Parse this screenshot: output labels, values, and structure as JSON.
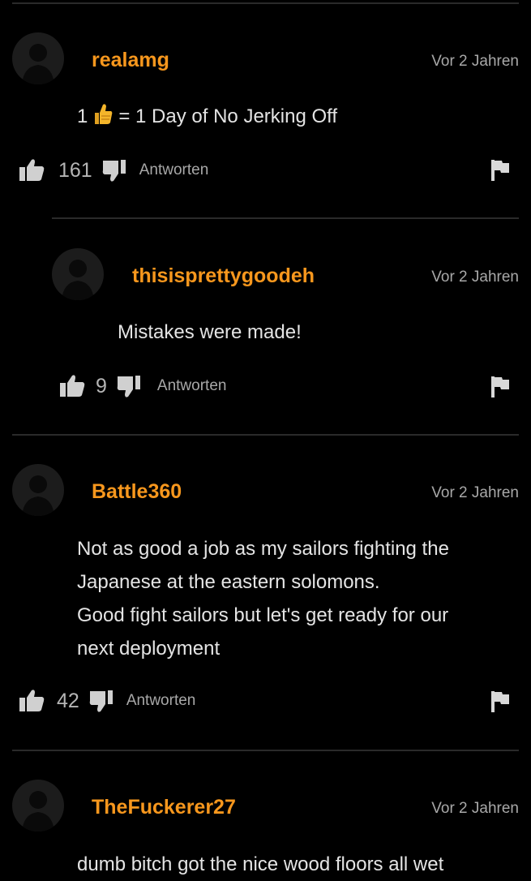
{
  "comments": [
    {
      "username": "realamg",
      "time": "Vor 2 Jahren",
      "text_pre": "1",
      "text_emoji": "thumbs-up-emoji",
      "text_post": "= 1 Day of No Jerking Off",
      "likes": "161",
      "reply_label": "Antworten"
    },
    {
      "username": "thisisprettygoodeh",
      "time": "Vor 2 Jahren",
      "text": "Mistakes were made!",
      "likes": "9",
      "reply_label": "Antworten"
    },
    {
      "username": "Battle360",
      "time": "Vor 2 Jahren",
      "lines": [
        "Not as good a job as my sailors fighting the",
        "Japanese at the eastern solomons.",
        "Good fight sailors but let's get ready for our",
        "next deployment"
      ],
      "likes": "42",
      "reply_label": "Antworten"
    },
    {
      "username": "TheFuckerer27",
      "time": "Vor 2 Jahren",
      "text": "dumb bitch got the nice wood floors all wet"
    }
  ],
  "colors": {
    "background": "#000000",
    "username": "#f7971d",
    "muted": "#a8a8a8",
    "divider": "#2a2a2a"
  },
  "icons": [
    "avatar-icon",
    "thumbs-up-icon",
    "thumbs-down-icon",
    "flag-icon",
    "thumbs-up-emoji"
  ]
}
